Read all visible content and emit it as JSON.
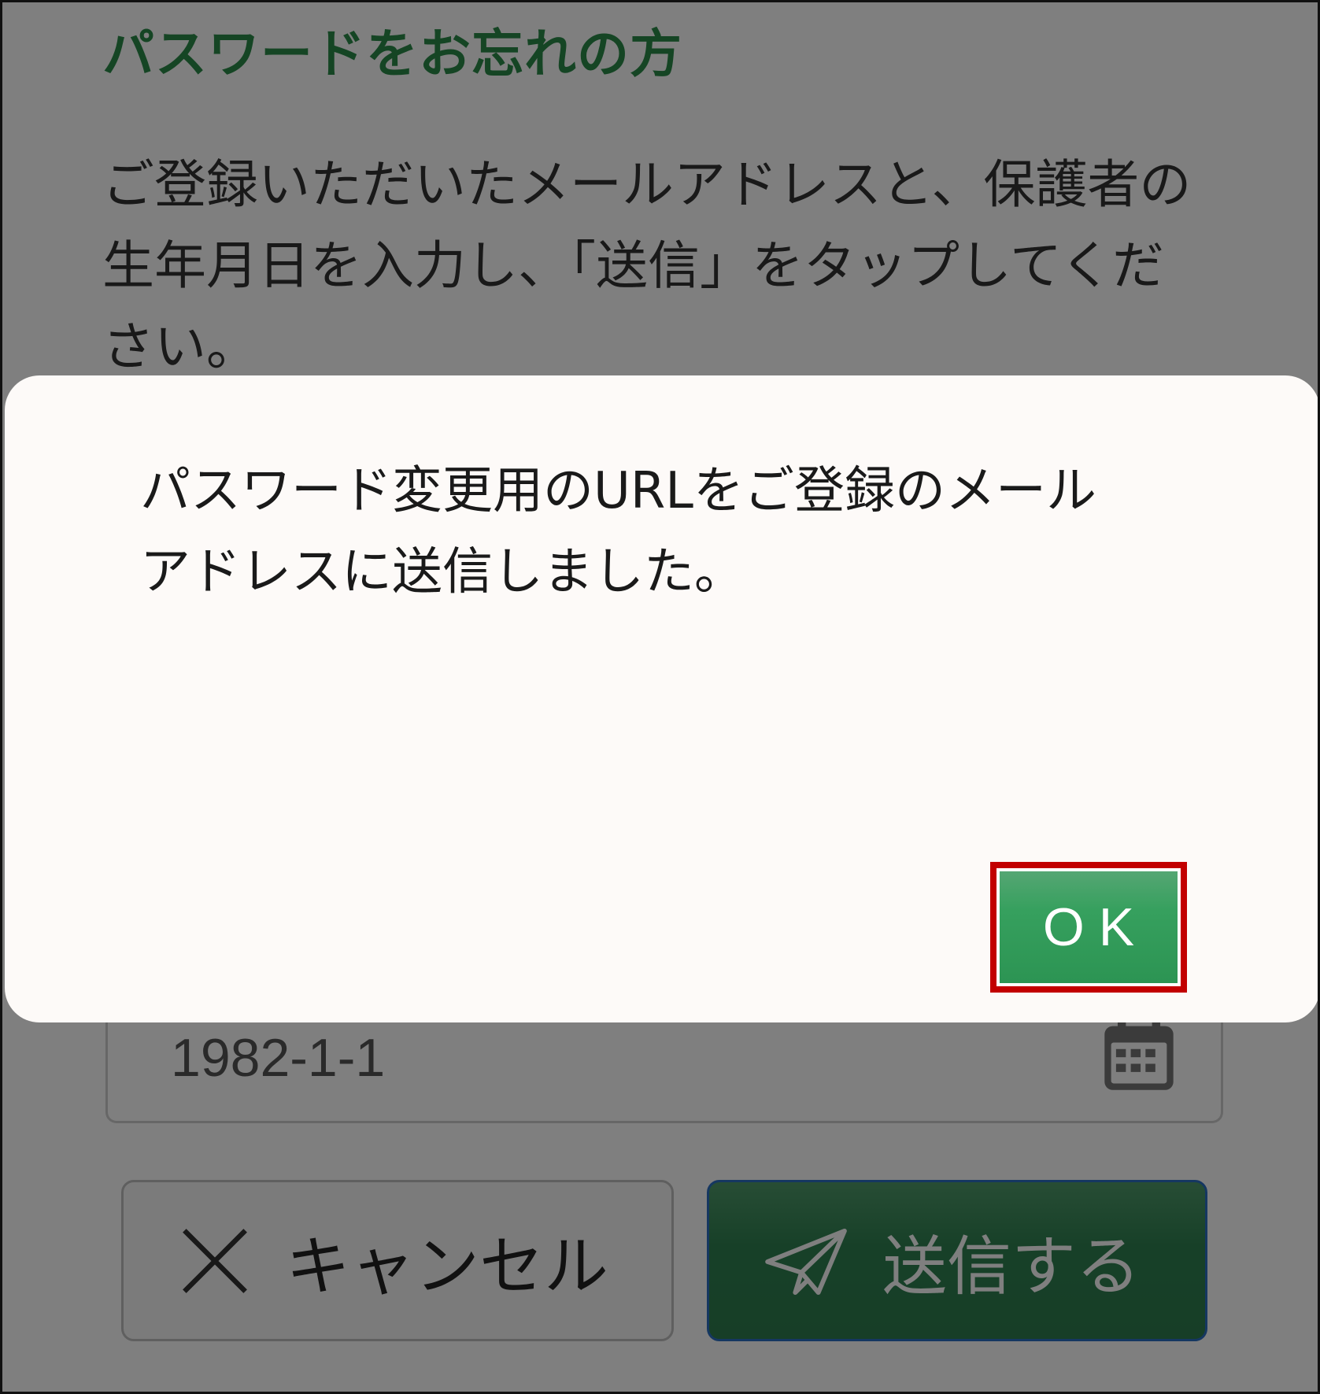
{
  "page": {
    "title": "パスワードをお忘れの方",
    "instruction": "ご登録いただいたメールアドレスと、保護者の生年月日を入力し、「送信」をタップしてください。",
    "birthdate_value": "1982-1-1",
    "cancel_label": "キャンセル",
    "send_label": "送信する"
  },
  "icons": {
    "calendar": "calendar-icon",
    "cancel": "close-icon",
    "send": "paper-plane-icon"
  },
  "dialog": {
    "message_line1": "パスワード変更用のURLをご登録のメール",
    "message_line2": "アドレスに送信しました。",
    "ok_label": "OK"
  },
  "colors": {
    "title_green": "#2a8a48",
    "button_green": "#36a05e",
    "highlight_red": "#c20000",
    "overlay": "rgba(0,0,0,0.5)"
  }
}
